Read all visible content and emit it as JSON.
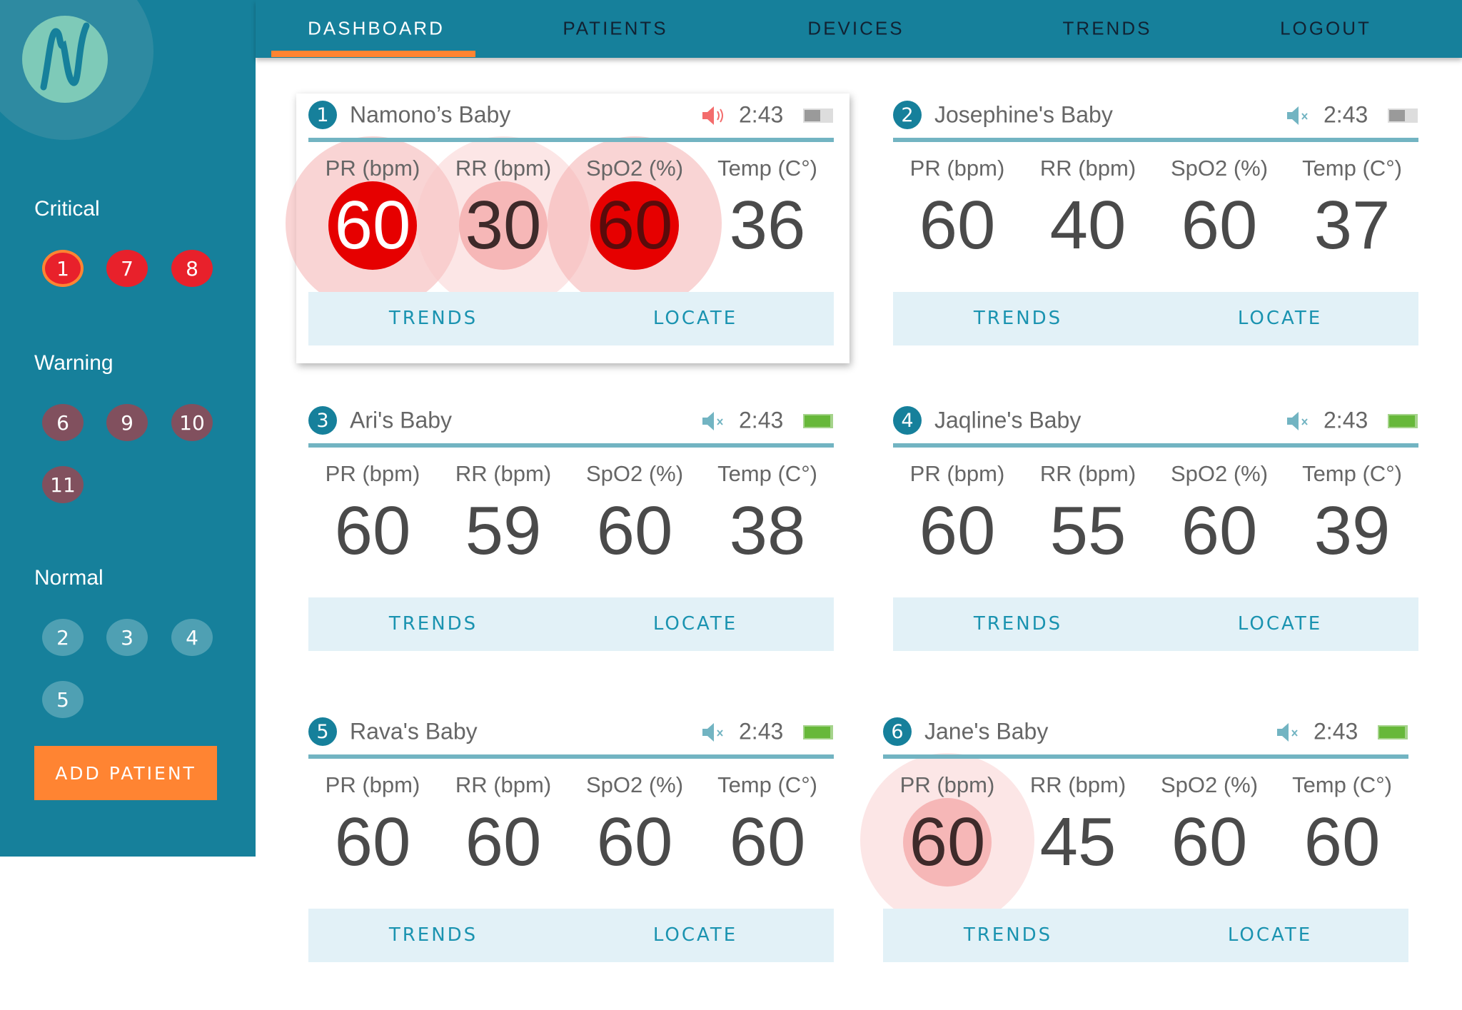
{
  "nav": {
    "items": [
      "DASHBOARD",
      "PATIENTS",
      "DEVICES",
      "TRENDS",
      "LOGOUT"
    ],
    "active": "DASHBOARD"
  },
  "sidebar": {
    "sections": [
      {
        "label": "Critical",
        "status": "critical",
        "badges": [
          "1",
          "7",
          "8"
        ],
        "selected": "1"
      },
      {
        "label": "Warning",
        "status": "warning",
        "badges": [
          "6",
          "9",
          "10",
          "11"
        ]
      },
      {
        "label": "Normal",
        "status": "normal",
        "badges": [
          "2",
          "3",
          "4",
          "5"
        ]
      }
    ],
    "add_patient": "ADD PATIENT"
  },
  "vital_labels": [
    "PR (bpm)",
    "RR (bpm)",
    "SpO2 (%)",
    "Temp (C°)"
  ],
  "buttons": {
    "trends": "TRENDS",
    "locate": "LOCATE"
  },
  "colors": {
    "brand": "#16809b",
    "accent": "#ff8432",
    "critical": "#e60000",
    "warning": "#f6b7b7"
  },
  "patients": [
    {
      "num": "1",
      "name": "Namono’s Baby",
      "time": "2:43",
      "sound": "on",
      "battery": "low",
      "values": [
        "60",
        "30",
        "60",
        "36"
      ],
      "alerts": [
        "critical",
        "warning",
        "critical-dark",
        "none"
      ]
    },
    {
      "num": "2",
      "name": "Josephine's Baby",
      "time": "2:43",
      "sound": "muted",
      "battery": "low",
      "values": [
        "60",
        "40",
        "60",
        "37"
      ],
      "alerts": [
        "none",
        "none",
        "none",
        "none"
      ]
    },
    {
      "num": "3",
      "name": "Ari's Baby",
      "time": "2:43",
      "sound": "muted",
      "battery": "full",
      "values": [
        "60",
        "59",
        "60",
        "38"
      ],
      "alerts": [
        "none",
        "none",
        "none",
        "none"
      ]
    },
    {
      "num": "4",
      "name": "Jaqline's Baby",
      "time": "2:43",
      "sound": "muted",
      "battery": "full",
      "values": [
        "60",
        "55",
        "60",
        "39"
      ],
      "alerts": [
        "none",
        "none",
        "none",
        "none"
      ]
    },
    {
      "num": "5",
      "name": "Rava's Baby",
      "time": "2:43",
      "sound": "muted",
      "battery": "full",
      "values": [
        "60",
        "60",
        "60",
        "60"
      ],
      "alerts": [
        "none",
        "none",
        "none",
        "none"
      ]
    },
    {
      "num": "6",
      "name": "Jane's Baby",
      "time": "2:43",
      "sound": "muted",
      "battery": "full",
      "values": [
        "60",
        "45",
        "60",
        "60"
      ],
      "alerts": [
        "warning",
        "none",
        "none",
        "none"
      ]
    }
  ]
}
